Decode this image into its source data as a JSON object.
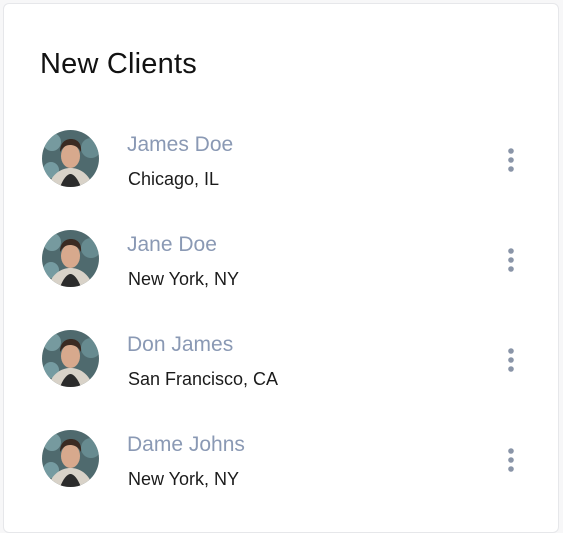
{
  "card": {
    "title": "New Clients"
  },
  "clients": [
    {
      "name": "James Doe",
      "location": "Chicago, IL"
    },
    {
      "name": "Jane Doe",
      "location": "New York, NY"
    },
    {
      "name": "Don James",
      "location": "San Francisco, CA"
    },
    {
      "name": "Dame Johns",
      "location": "New York, NY"
    }
  ],
  "icons": {
    "avatar": "avatar-photo",
    "more": "more-vertical-icon"
  },
  "colors": {
    "name": "#8a99b4",
    "location": "#1b1b1b",
    "title": "#121212",
    "icon": "#8a95a8"
  }
}
